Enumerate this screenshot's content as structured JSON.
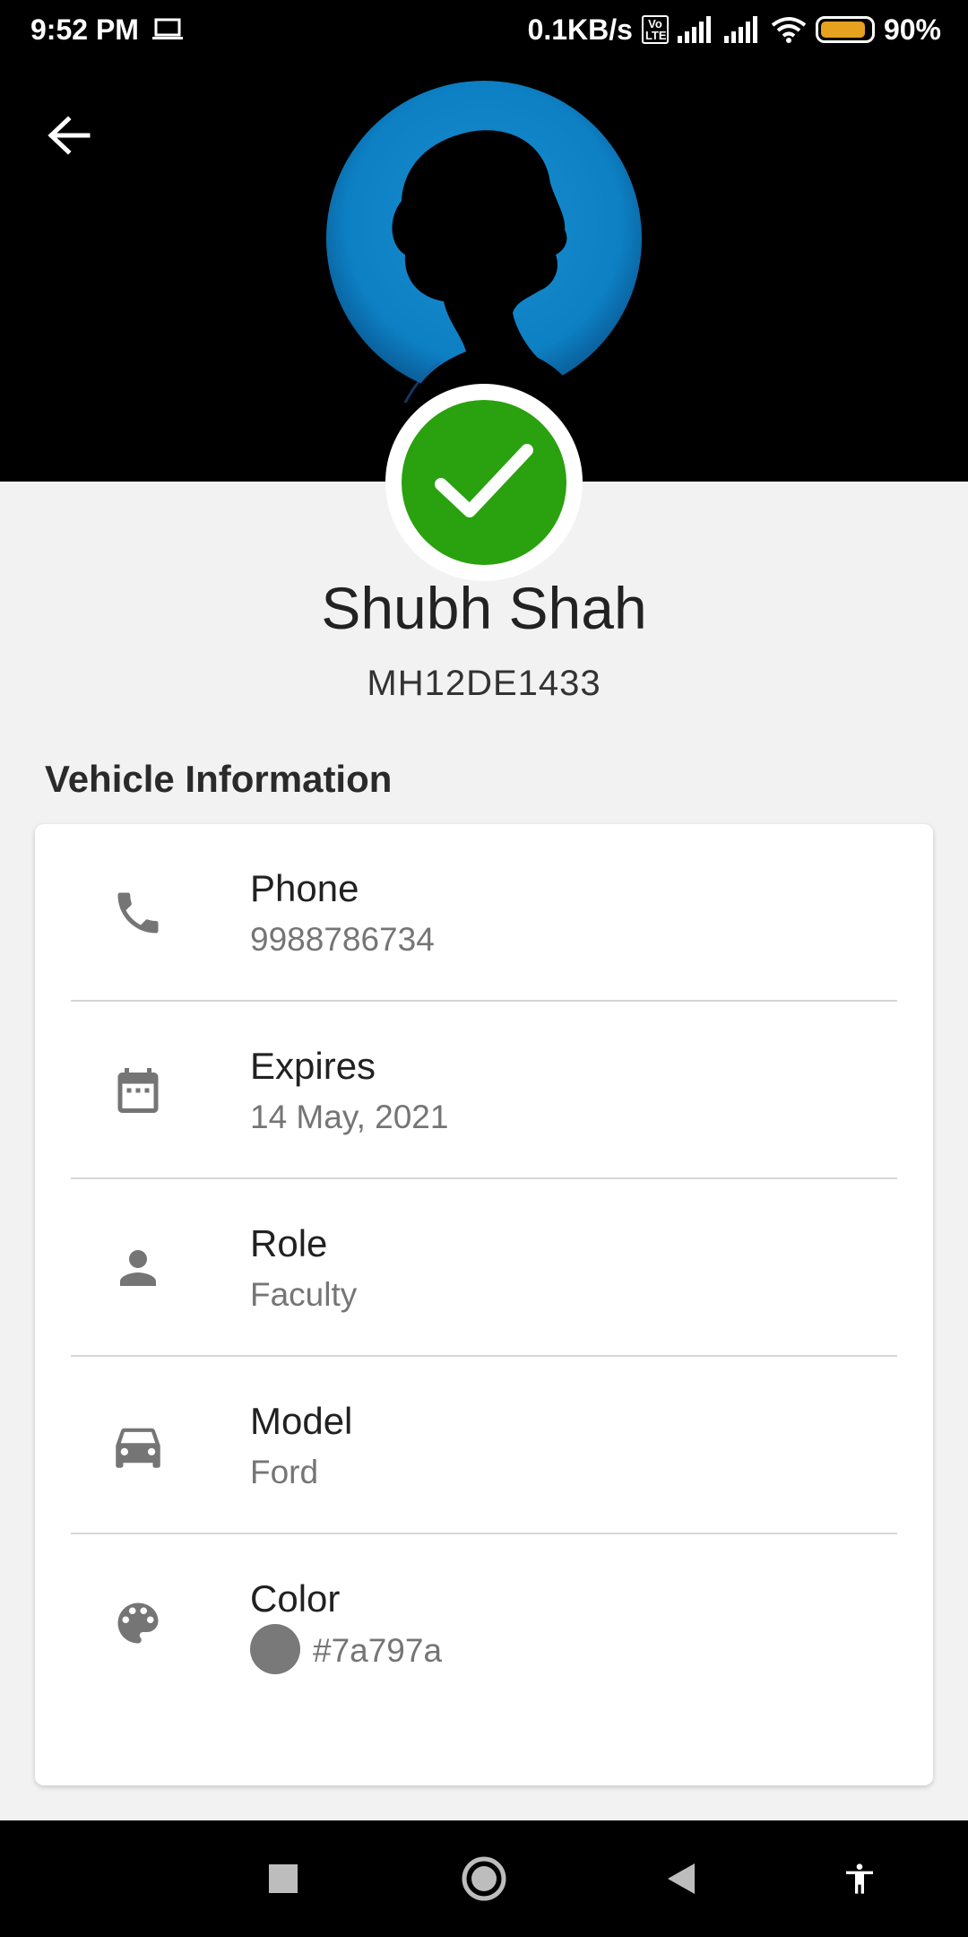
{
  "status_bar": {
    "time": "9:52 PM",
    "net_speed": "0.1KB/s",
    "volte_label": "Vo LTE",
    "battery_percent": "90%",
    "battery_level": 0.9,
    "battery_color": "#e6a11e"
  },
  "header": {
    "back_icon": "arrow-left-icon",
    "avatar": "profile-silhouette"
  },
  "profile": {
    "status_icon": "check-icon",
    "status_color": "#2aa10f",
    "name": "Shubh Shah",
    "plate": "MH12DE1433"
  },
  "section": {
    "title": "Vehicle Information"
  },
  "info": [
    {
      "icon": "phone-icon",
      "label": "Phone",
      "value": "9988786734"
    },
    {
      "icon": "calendar-icon",
      "label": "Expires",
      "value": "14 May, 2021"
    },
    {
      "icon": "person-icon",
      "label": "Role",
      "value": "Faculty"
    },
    {
      "icon": "car-icon",
      "label": "Model",
      "value": "Ford"
    },
    {
      "icon": "palette-icon",
      "label": "Color",
      "value": "#7a797a",
      "swatch": "#7a797a"
    }
  ],
  "nav_bar": {
    "items": [
      "recents-button",
      "home-button",
      "back-button",
      "accessibility-button"
    ]
  }
}
